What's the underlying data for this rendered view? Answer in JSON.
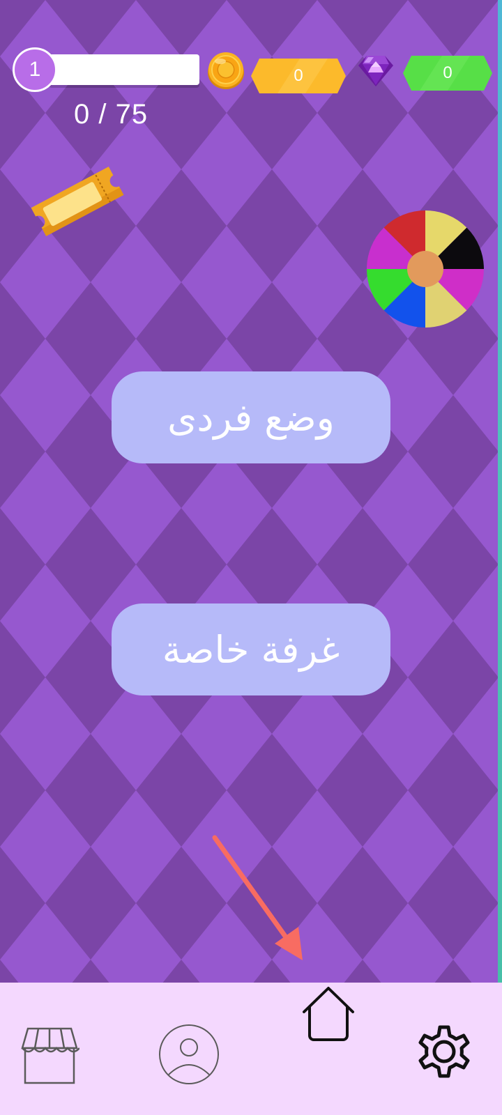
{
  "header": {
    "level": "1",
    "xp_progress": "0 / 75",
    "xp_fraction": 0,
    "coins": "0",
    "gems": "0"
  },
  "main": {
    "solo_mode_label": "وضع فردى",
    "private_room_label": "غرفة خاصة"
  },
  "icons": {
    "coin": "coin-icon",
    "gem": "gem-icon",
    "ticket": "ticket-icon",
    "wheel": "spin-wheel-icon",
    "arrow": "pointer-arrow-icon"
  },
  "nav": {
    "items": [
      "shop-icon",
      "profile-icon",
      "home-icon",
      "settings-icon"
    ]
  },
  "colors": {
    "background_dark": "#7b45a7",
    "background_light": "#9658cf",
    "button_fill": "#b6baf9",
    "coin_box": "#fcba2b",
    "gem_box": "#57df47",
    "nav_background": "#f4d8fe",
    "arrow": "#f86c62"
  }
}
